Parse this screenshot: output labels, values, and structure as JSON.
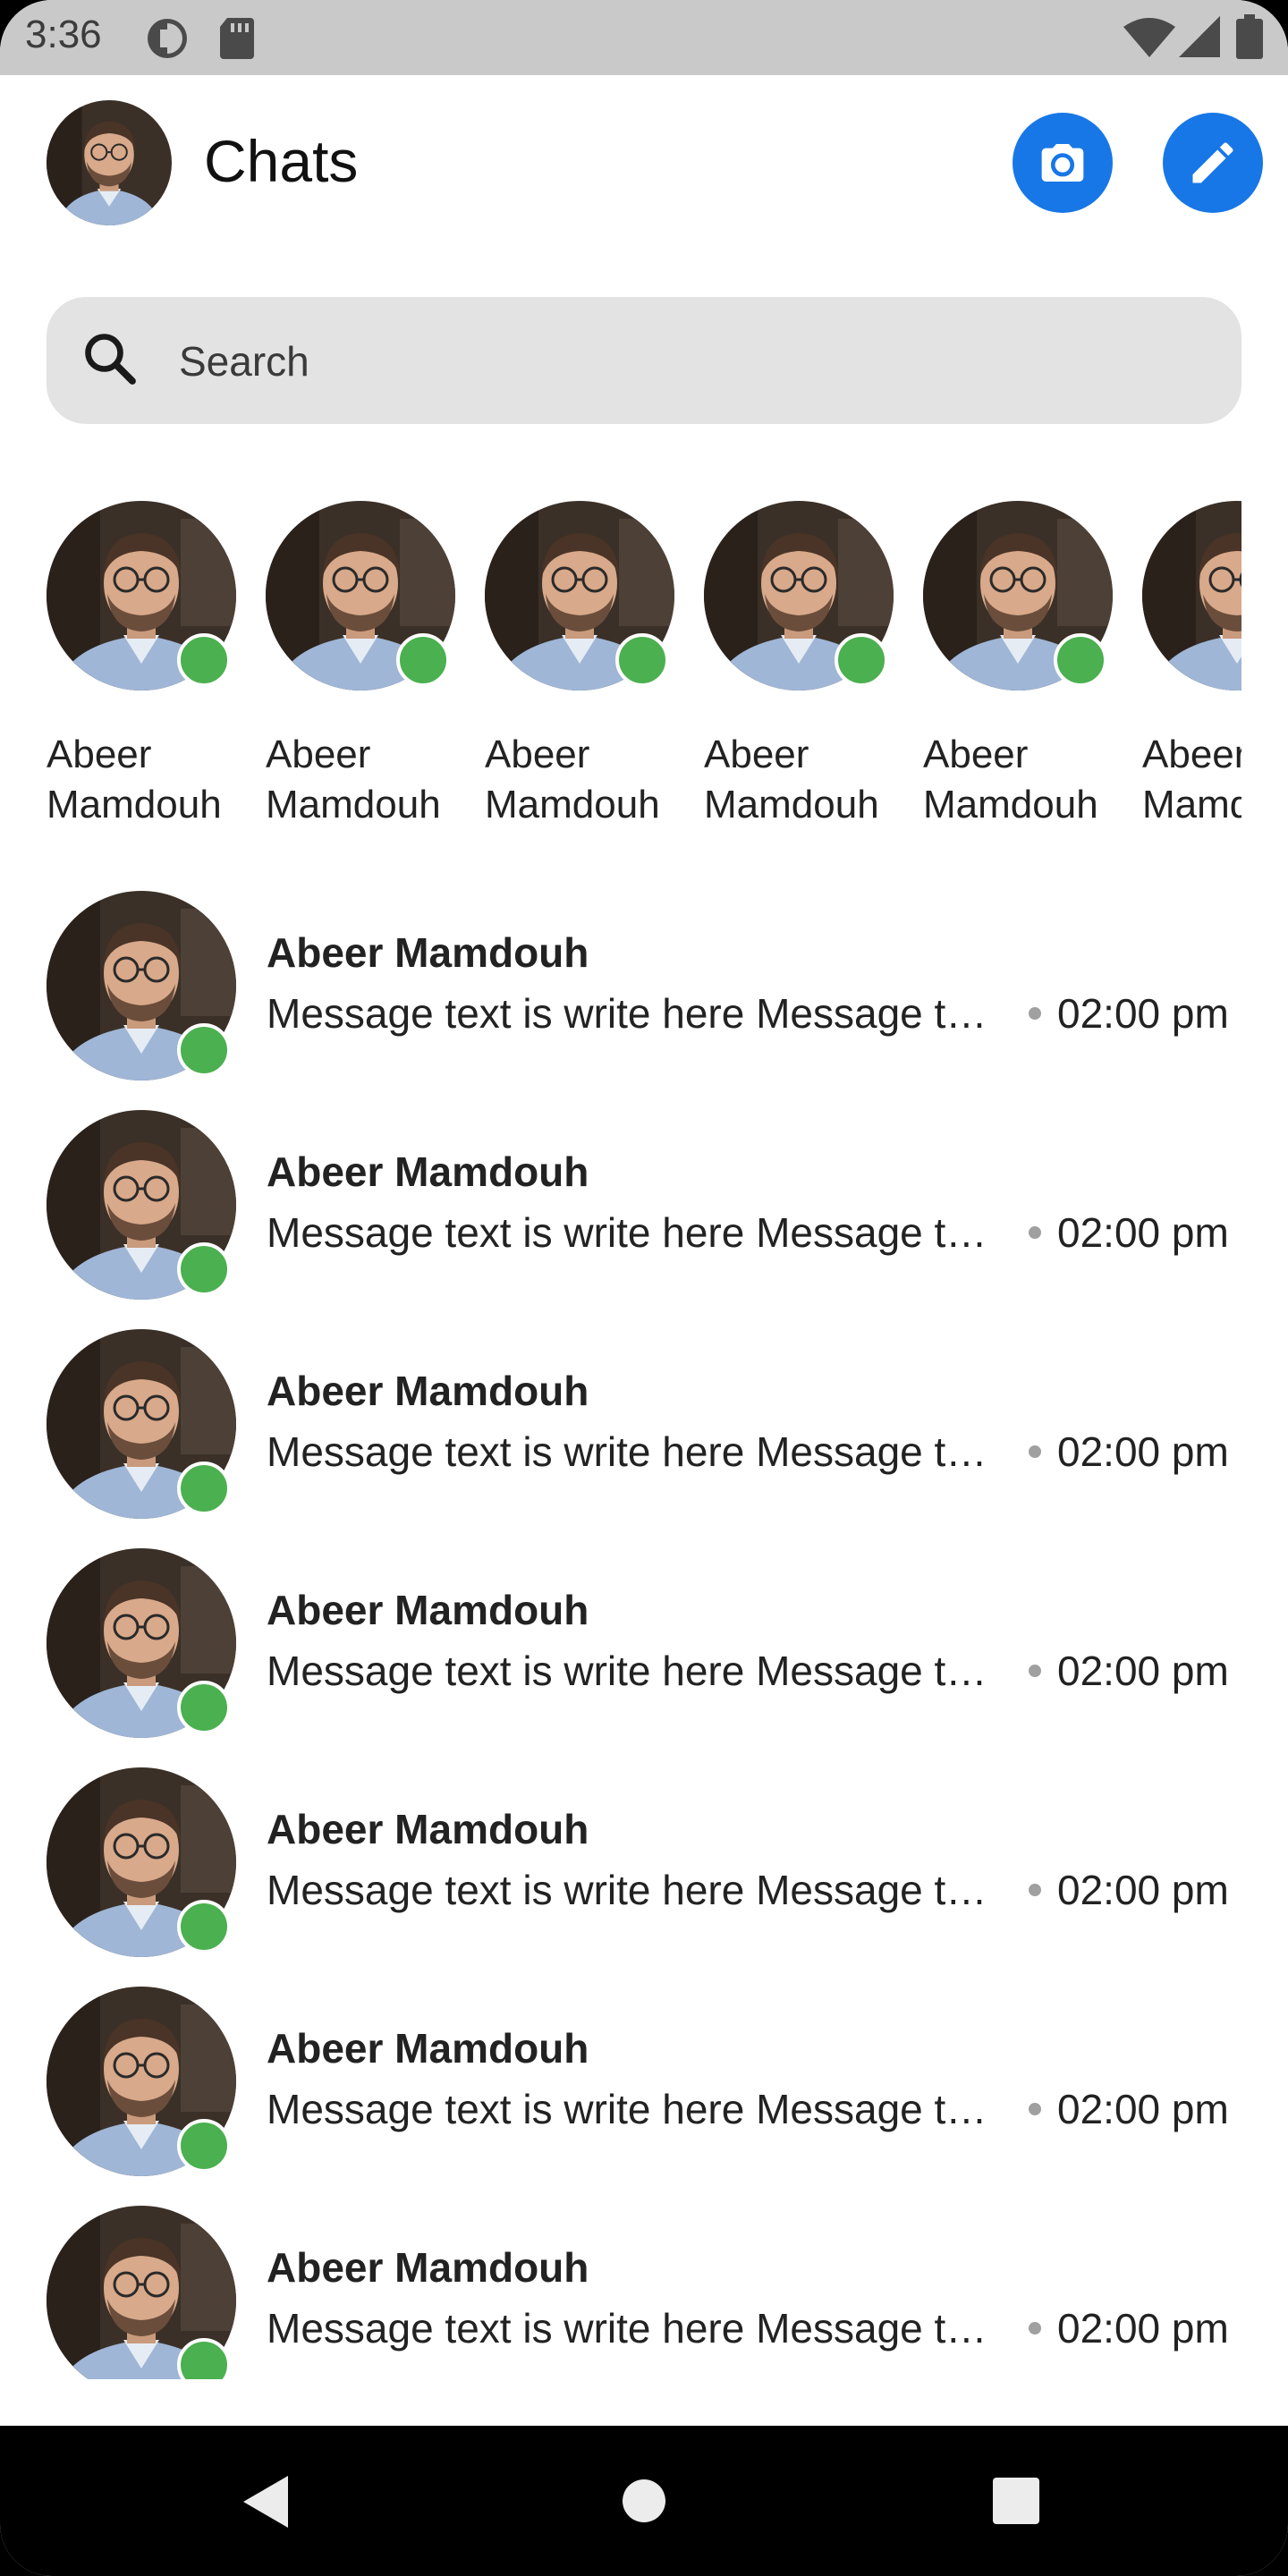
{
  "status_bar": {
    "time": "3:36",
    "icons": [
      "sync-icon",
      "sd-card-icon",
      "wifi-icon",
      "signal-icon",
      "battery-icon"
    ]
  },
  "header": {
    "title": "Chats",
    "camera_icon": "camera-icon",
    "edit_icon": "pencil-icon",
    "accent_color": "#1877e6"
  },
  "search": {
    "placeholder": "Search",
    "icon": "search-icon"
  },
  "stories": [
    {
      "first": "Abeer",
      "last": "Mamdouh",
      "online": true
    },
    {
      "first": "Abeer",
      "last": "Mamdouh",
      "online": true
    },
    {
      "first": "Abeer",
      "last": "Mamdouh",
      "online": true
    },
    {
      "first": "Abeer",
      "last": "Mamdouh",
      "online": true
    },
    {
      "first": "Abeer",
      "last": "Mamdouh",
      "online": true
    },
    {
      "first": "Abeer",
      "last": "Mamdouh",
      "online": true
    }
  ],
  "chats": [
    {
      "name": "Abeer Mamdouh",
      "preview": "Message text is write here Message text is write here",
      "time": "02:00 pm",
      "online": true
    },
    {
      "name": "Abeer Mamdouh",
      "preview": "Message text is write here Message text is write here",
      "time": "02:00 pm",
      "online": true
    },
    {
      "name": "Abeer Mamdouh",
      "preview": "Message text is write here Message text is write here",
      "time": "02:00 pm",
      "online": true
    },
    {
      "name": "Abeer Mamdouh",
      "preview": "Message text is write here Message text is write here",
      "time": "02:00 pm",
      "online": true
    },
    {
      "name": "Abeer Mamdouh",
      "preview": "Message text is write here Message text is write here",
      "time": "02:00 pm",
      "online": true
    },
    {
      "name": "Abeer Mamdouh",
      "preview": "Message text is write here Message text is write here",
      "time": "02:00 pm",
      "online": true
    },
    {
      "name": "Abeer Mamdouh",
      "preview": "Message text is write here Message text is write here",
      "time": "02:00 pm",
      "online": true
    }
  ],
  "nav": {
    "back_icon": "back-triangle-icon",
    "home_icon": "home-circle-icon",
    "recents_icon": "recents-square-icon"
  },
  "colors": {
    "online": "#4bb04f",
    "search_bg": "#e3e3e3",
    "status_bar_bg": "#c9c9c9"
  }
}
